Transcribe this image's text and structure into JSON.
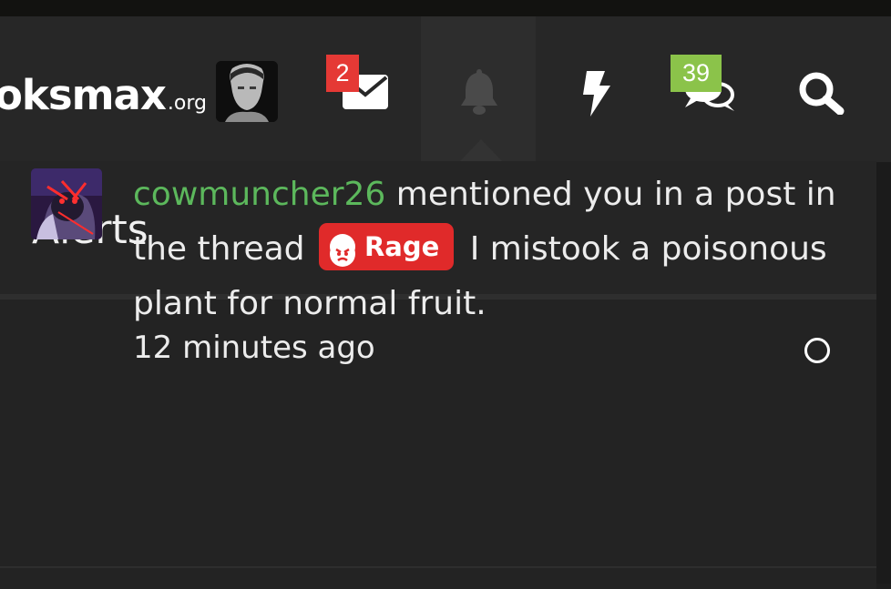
{
  "header": {
    "logo_text": "oksmax",
    "logo_tld": ".org",
    "nav": {
      "conversations": {
        "badge": "2",
        "icon": "envelope-icon"
      },
      "alerts": {
        "icon": "bell-icon"
      },
      "whats_new": {
        "icon": "lightning-icon"
      },
      "chat": {
        "badge": "39",
        "icon": "chat-bubbles-icon"
      },
      "search": {
        "icon": "search-icon"
      }
    }
  },
  "alerts_panel": {
    "title": "Alerts",
    "items": [
      {
        "username": "cowmuncher26",
        "text_before": " mentioned you in a post in the thread ",
        "prefix_label": "Rage",
        "thread_title": " I mistook a poisonous plant for normal fruit.",
        "time": "12 minutes ago"
      }
    ]
  },
  "colors": {
    "username": "#5cb85c",
    "badge_red": "#e53935",
    "badge_green": "#8bc34a",
    "prefix_rage": "#e02a2a"
  }
}
